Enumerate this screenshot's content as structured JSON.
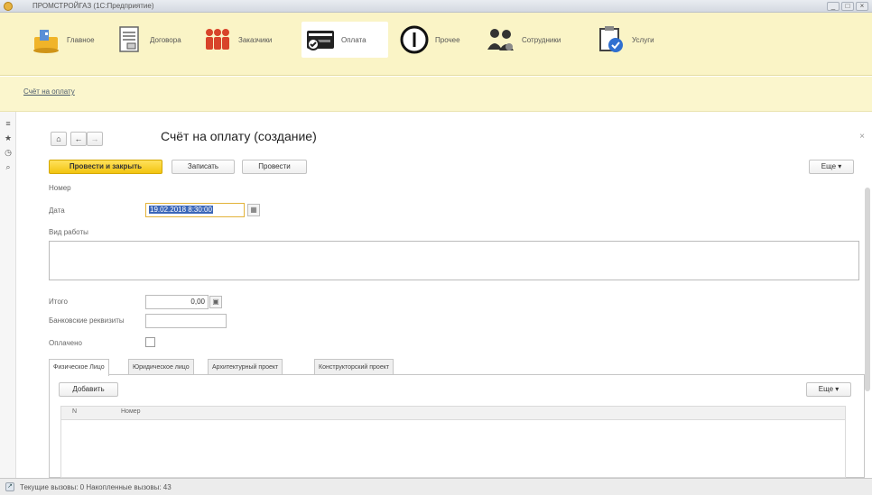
{
  "window": {
    "title": "ПРОМСТРОЙГАЗ (1С:Предприятие)",
    "controls": [
      "_",
      "□",
      "×"
    ]
  },
  "sections": [
    {
      "label": "Главное",
      "icon": "home-icon"
    },
    {
      "label": "Договора",
      "icon": "document-icon"
    },
    {
      "label": "Заказчики",
      "icon": "people-icon"
    },
    {
      "label": "Оплата",
      "icon": "payment-card-icon",
      "active": true
    },
    {
      "label": "Прочее",
      "icon": "info-icon"
    },
    {
      "label": "Сотрудники",
      "icon": "employees-icon"
    },
    {
      "label": "Услуги",
      "icon": "services-icon"
    }
  ],
  "breadcrumb": {
    "label": "Счёт на оплату"
  },
  "leftbar": {
    "icons": [
      "menu-icon",
      "star-icon",
      "history-icon",
      "search-icon"
    ]
  },
  "form": {
    "nav": {
      "home": "⌂",
      "back": "←",
      "forward": "→"
    },
    "title": "Счёт на оплату (создание)",
    "close": "×",
    "buttons": {
      "post_close": "Провести и закрыть",
      "save": "Записать",
      "post": "Провести",
      "more": "Еще"
    },
    "fields": {
      "number_label": "Номер",
      "number_value": "",
      "date_label": "Дата",
      "date_value": "19.02.2018 8:30:00",
      "work_label": "Вид работы",
      "work_value": "",
      "total_label": "Итого",
      "total_value": "0,00",
      "bank_label": "Банковские реквизиты",
      "bank_value": "",
      "paid_label": "Оплачено",
      "paid_checked": false
    },
    "tabs": [
      {
        "label": "Физическое Лицо",
        "active": true
      },
      {
        "label": "Юридическое лицо"
      },
      {
        "label": "Архитектурный проект"
      },
      {
        "label": "Конструкторский проект"
      }
    ],
    "table": {
      "add_label": "Добавить",
      "more_label": "Еще",
      "columns": [
        "N",
        "Номер"
      ],
      "rows": []
    }
  },
  "status": {
    "text": "Текущие вызовы: 0   Накопленные вызовы: 43"
  },
  "colors": {
    "sections_bg": "#faf4c6",
    "primary_button": "#f2c410",
    "selection": "#3b66b8"
  }
}
